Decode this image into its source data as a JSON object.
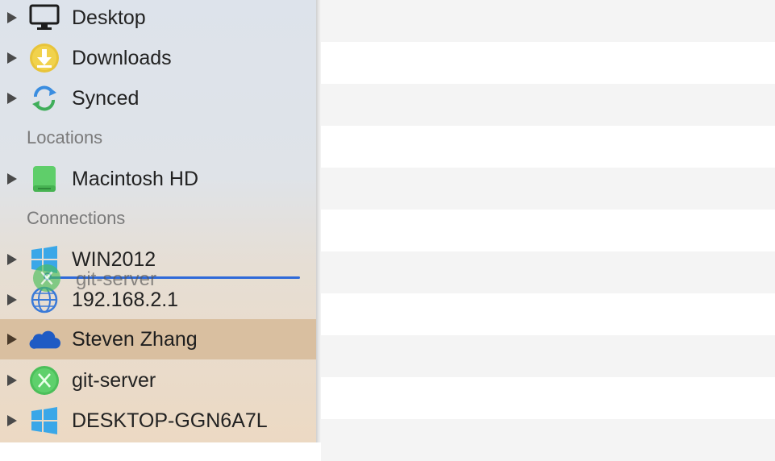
{
  "sidebar": {
    "favorites": [
      {
        "label": "Desktop",
        "icon": "desktop-icon"
      },
      {
        "label": "Downloads",
        "icon": "downloads-icon"
      },
      {
        "label": "Synced",
        "icon": "sync-icon"
      }
    ],
    "locations_header": "Locations",
    "locations": [
      {
        "label": "Macintosh HD",
        "icon": "hard-drive-icon"
      }
    ],
    "connections_header": "Connections",
    "connections": [
      {
        "label": "WIN2012",
        "icon": "windows-icon"
      },
      {
        "label": "192.168.2.1",
        "icon": "globe-icon"
      },
      {
        "label": "Steven Zhang",
        "icon": "onedrive-cloud-icon",
        "selected": true
      },
      {
        "label": "git-server",
        "icon": "git-server-icon"
      },
      {
        "label": "DESKTOP-GGN6A7L",
        "icon": "windows-icon"
      }
    ],
    "drag_ghost_label": "git-server"
  },
  "colors": {
    "accent": "#2f6ad9",
    "selected_row": "#d9bfa0",
    "stripe": "#f4f4f4"
  }
}
